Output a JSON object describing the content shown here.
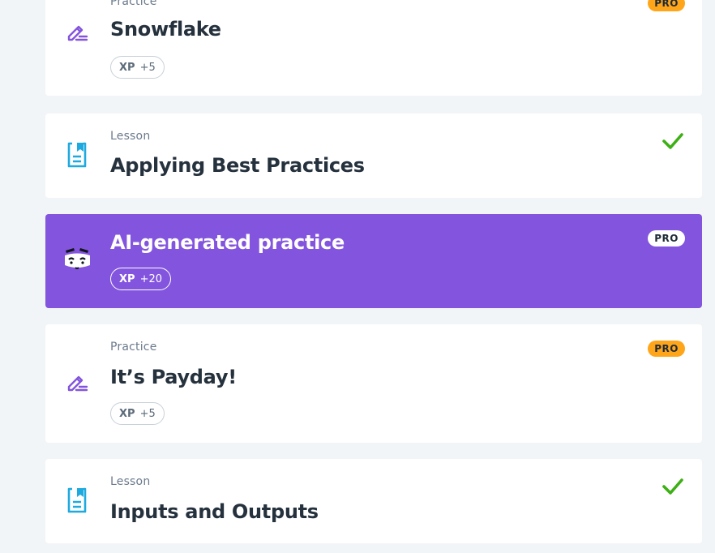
{
  "colors": {
    "page_bg": "#f2f5f7",
    "card_bg": "#ffffff",
    "ai_card_bg": "#8354dd",
    "practice_icon": "#8354dd",
    "lesson_icon": "#1faadf",
    "pro_badge": "#ffa51a",
    "check": "#3db015",
    "title_text": "#25313d",
    "muted_text": "#6b7a8c"
  },
  "items": [
    {
      "type": "Practice",
      "title": "Snowflake",
      "icon": "pencil-icon",
      "xp_label": "XP",
      "xp_value": "+5",
      "badge": "PRO",
      "completed": false
    },
    {
      "type": "Lesson",
      "title": "Applying Best Practices",
      "icon": "book-icon",
      "completed": true
    },
    {
      "title": "AI-generated practice",
      "icon": "ai-mascot-icon",
      "xp_label": "XP",
      "xp_value": "+20",
      "badge": "PRO",
      "completed": false
    },
    {
      "type": "Practice",
      "title": "It’s Payday!",
      "icon": "pencil-icon",
      "xp_label": "XP",
      "xp_value": "+5",
      "badge": "PRO",
      "completed": false
    },
    {
      "type": "Lesson",
      "title": "Inputs and Outputs",
      "icon": "book-icon",
      "completed": true
    }
  ]
}
